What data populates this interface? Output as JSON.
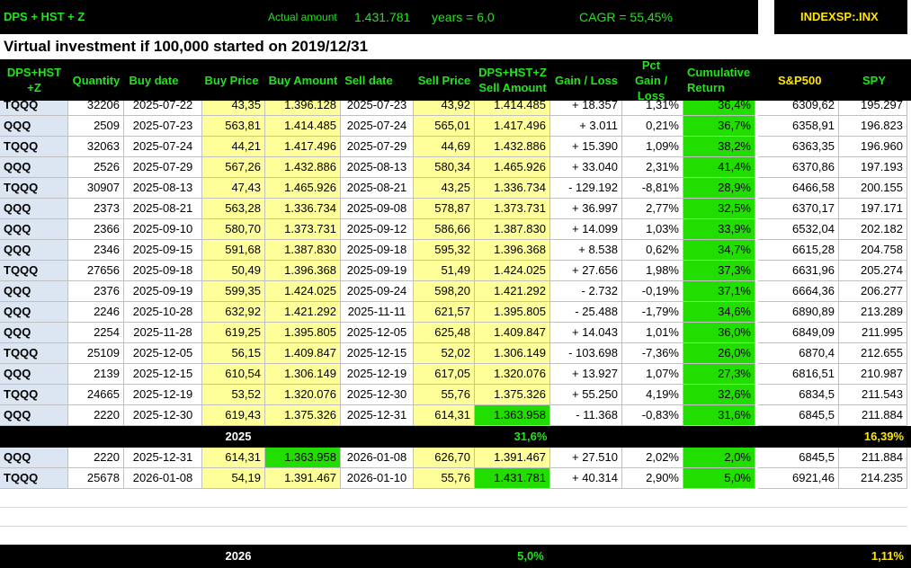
{
  "top": {
    "label": "DPS + HST + Z",
    "actual_label": "Actual amount",
    "actual_value": "1.431.781",
    "years": "years =  6,0",
    "cagr": "CAGR =  55,45%",
    "index": "INDEXSP:.INX"
  },
  "subtitle": "Virtual investment if 100,000 started on 2019/12/31",
  "columns": {
    "ticker": "DPS+HST +Z",
    "qty": "Quantity",
    "buy_date": "Buy date",
    "buy_price": "Buy Price",
    "buy_amount": "Buy Amount",
    "sell_date": "Sell date",
    "sell_price": "Sell Price",
    "sell_amount": "DPS+HST+Z Sell Amount",
    "gain": "Gain / Loss",
    "pct": "Pct Gain / Loss",
    "cum": "Cumulative Return",
    "sp": "S&P500",
    "spy": "SPY"
  },
  "rows_2025": [
    {
      "t": "TQQQ",
      "q": "32206",
      "bd": "2025-07-22",
      "bp": "43,35",
      "ba": "1.396.128",
      "sd": "2025-07-23",
      "sp": "43,92",
      "sa": "1.414.485",
      "g": "+ 18.357",
      "p": "1,31%",
      "c": "36,4%",
      "s": "6309,62",
      "y": "195.297"
    },
    {
      "t": "QQQ",
      "q": "2509",
      "bd": "2025-07-23",
      "bp": "563,81",
      "ba": "1.414.485",
      "sd": "2025-07-24",
      "sp": "565,01",
      "sa": "1.417.496",
      "g": "+ 3.011",
      "p": "0,21%",
      "c": "36,7%",
      "s": "6358,91",
      "y": "196.823"
    },
    {
      "t": "TQQQ",
      "q": "32063",
      "bd": "2025-07-24",
      "bp": "44,21",
      "ba": "1.417.496",
      "sd": "2025-07-29",
      "sp": "44,69",
      "sa": "1.432.886",
      "g": "+ 15.390",
      "p": "1,09%",
      "c": "38,2%",
      "s": "6363,35",
      "y": "196.960"
    },
    {
      "t": "QQQ",
      "q": "2526",
      "bd": "2025-07-29",
      "bp": "567,26",
      "ba": "1.432.886",
      "sd": "2025-08-13",
      "sp": "580,34",
      "sa": "1.465.926",
      "g": "+ 33.040",
      "p": "2,31%",
      "c": "41,4%",
      "s": "6370,86",
      "y": "197.193"
    },
    {
      "t": "TQQQ",
      "q": "30907",
      "bd": "2025-08-13",
      "bp": "47,43",
      "ba": "1.465.926",
      "sd": "2025-08-21",
      "sp": "43,25",
      "sa": "1.336.734",
      "g": "- 129.192",
      "p": "-8,81%",
      "c": "28,9%",
      "s": "6466,58",
      "y": "200.155"
    },
    {
      "t": "QQQ",
      "q": "2373",
      "bd": "2025-08-21",
      "bp": "563,28",
      "ba": "1.336.734",
      "sd": "2025-09-08",
      "sp": "578,87",
      "sa": "1.373.731",
      "g": "+ 36.997",
      "p": "2,77%",
      "c": "32,5%",
      "s": "6370,17",
      "y": "197.171"
    },
    {
      "t": "QQQ",
      "q": "2366",
      "bd": "2025-09-10",
      "bp": "580,70",
      "ba": "1.373.731",
      "sd": "2025-09-12",
      "sp": "586,66",
      "sa": "1.387.830",
      "g": "+ 14.099",
      "p": "1,03%",
      "c": "33,9%",
      "s": "6532,04",
      "y": "202.182"
    },
    {
      "t": "QQQ",
      "q": "2346",
      "bd": "2025-09-15",
      "bp": "591,68",
      "ba": "1.387.830",
      "sd": "2025-09-18",
      "sp": "595,32",
      "sa": "1.396.368",
      "g": "+ 8.538",
      "p": "0,62%",
      "c": "34,7%",
      "s": "6615,28",
      "y": "204.758"
    },
    {
      "t": "TQQQ",
      "q": "27656",
      "bd": "2025-09-18",
      "bp": "50,49",
      "ba": "1.396.368",
      "sd": "2025-09-19",
      "sp": "51,49",
      "sa": "1.424.025",
      "g": "+ 27.656",
      "p": "1,98%",
      "c": "37,3%",
      "s": "6631,96",
      "y": "205.274"
    },
    {
      "t": "QQQ",
      "q": "2376",
      "bd": "2025-09-19",
      "bp": "599,35",
      "ba": "1.424.025",
      "sd": "2025-09-24",
      "sp": "598,20",
      "sa": "1.421.292",
      "g": "- 2.732",
      "p": "-0,19%",
      "c": "37,1%",
      "s": "6664,36",
      "y": "206.277"
    },
    {
      "t": "QQQ",
      "q": "2246",
      "bd": "2025-10-28",
      "bp": "632,92",
      "ba": "1.421.292",
      "sd": "2025-11-11",
      "sp": "621,57",
      "sa": "1.395.805",
      "g": "- 25.488",
      "p": "-1,79%",
      "c": "34,6%",
      "s": "6890,89",
      "y": "213.289"
    },
    {
      "t": "QQQ",
      "q": "2254",
      "bd": "2025-11-28",
      "bp": "619,25",
      "ba": "1.395.805",
      "sd": "2025-12-05",
      "sp": "625,48",
      "sa": "1.409.847",
      "g": "+ 14.043",
      "p": "1,01%",
      "c": "36,0%",
      "s": "6849,09",
      "y": "211.995"
    },
    {
      "t": "TQQQ",
      "q": "25109",
      "bd": "2025-12-05",
      "bp": "56,15",
      "ba": "1.409.847",
      "sd": "2025-12-15",
      "sp": "52,02",
      "sa": "1.306.149",
      "g": "- 103.698",
      "p": "-7,36%",
      "c": "26,0%",
      "s": "6870,4",
      "y": "212.655"
    },
    {
      "t": "QQQ",
      "q": "2139",
      "bd": "2025-12-15",
      "bp": "610,54",
      "ba": "1.306.149",
      "sd": "2025-12-19",
      "sp": "617,05",
      "sa": "1.320.076",
      "g": "+ 13.927",
      "p": "1,07%",
      "c": "27,3%",
      "s": "6816,51",
      "y": "210.987"
    },
    {
      "t": "TQQQ",
      "q": "24665",
      "bd": "2025-12-19",
      "bp": "53,52",
      "ba": "1.320.076",
      "sd": "2025-12-30",
      "sp": "55,76",
      "sa": "1.375.326",
      "g": "+ 55.250",
      "p": "4,19%",
      "c": "32,6%",
      "s": "6834,5",
      "y": "211.543"
    },
    {
      "t": "QQQ",
      "q": "2220",
      "bd": "2025-12-30",
      "bp": "619,43",
      "ba": "1.375.326",
      "sd": "2025-12-31",
      "sp": "614,31",
      "sa": "1.363.958",
      "g": "- 11.368",
      "p": "-0,83%",
      "c": "31,6%",
      "s": "6845,5",
      "y": "211.884"
    }
  ],
  "summary_2025": {
    "year": "2025",
    "return": "31,6%",
    "sp": "16,39%"
  },
  "rows_2026": [
    {
      "t": "QQQ",
      "q": "2220",
      "bd": "2025-12-31",
      "bp": "614,31",
      "ba": "1.363.958",
      "sd": "2026-01-08",
      "sp": "626,70",
      "sa": "1.391.467",
      "g": "+ 27.510",
      "p": "2,02%",
      "c": "2,0%",
      "s": "6845,5",
      "y": "211.884"
    },
    {
      "t": "TQQQ",
      "q": "25678",
      "bd": "2026-01-08",
      "bp": "54,19",
      "ba": "1.391.467",
      "sd": "2026-01-10",
      "sp": "55,76",
      "sa": "1.431.781",
      "g": "+ 40.314",
      "p": "2,90%",
      "c": "5,0%",
      "s": "6921,46",
      "y": "214.235"
    }
  ],
  "summary_2026": {
    "year": "2026",
    "return": "5,0%",
    "sp": "1,11%"
  },
  "colors": {
    "green": "#22e41c",
    "yellow_fill": "#ffff99",
    "blue_fill": "#dbe6f2",
    "bright_green": "#22dd00",
    "index_yellow": "#ffe600"
  }
}
